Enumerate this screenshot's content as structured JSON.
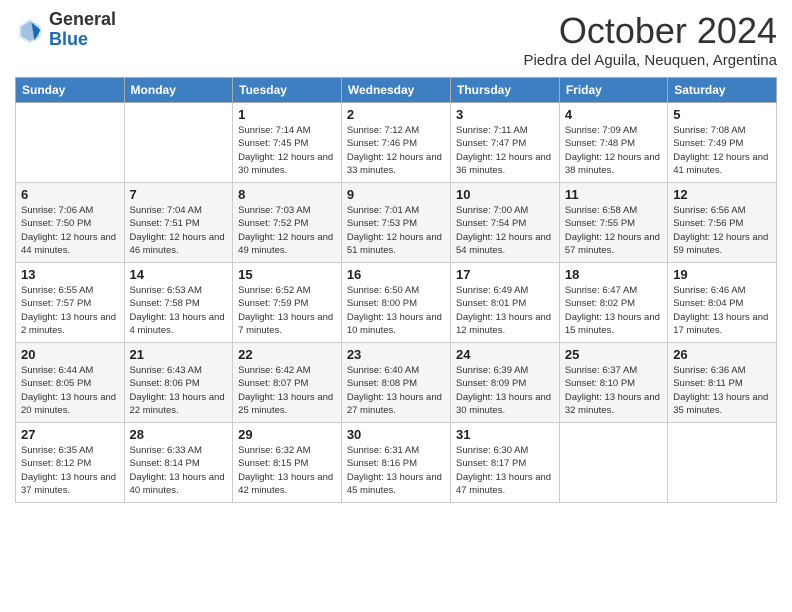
{
  "logo": {
    "general": "General",
    "blue": "Blue"
  },
  "header": {
    "month": "October 2024",
    "location": "Piedra del Aguila, Neuquen, Argentina"
  },
  "columns": [
    "Sunday",
    "Monday",
    "Tuesday",
    "Wednesday",
    "Thursday",
    "Friday",
    "Saturday"
  ],
  "weeks": [
    [
      {
        "day": "",
        "info": ""
      },
      {
        "day": "",
        "info": ""
      },
      {
        "day": "1",
        "info": "Sunrise: 7:14 AM\nSunset: 7:45 PM\nDaylight: 12 hours and 30 minutes."
      },
      {
        "day": "2",
        "info": "Sunrise: 7:12 AM\nSunset: 7:46 PM\nDaylight: 12 hours and 33 minutes."
      },
      {
        "day": "3",
        "info": "Sunrise: 7:11 AM\nSunset: 7:47 PM\nDaylight: 12 hours and 36 minutes."
      },
      {
        "day": "4",
        "info": "Sunrise: 7:09 AM\nSunset: 7:48 PM\nDaylight: 12 hours and 38 minutes."
      },
      {
        "day": "5",
        "info": "Sunrise: 7:08 AM\nSunset: 7:49 PM\nDaylight: 12 hours and 41 minutes."
      }
    ],
    [
      {
        "day": "6",
        "info": "Sunrise: 7:06 AM\nSunset: 7:50 PM\nDaylight: 12 hours and 44 minutes."
      },
      {
        "day": "7",
        "info": "Sunrise: 7:04 AM\nSunset: 7:51 PM\nDaylight: 12 hours and 46 minutes."
      },
      {
        "day": "8",
        "info": "Sunrise: 7:03 AM\nSunset: 7:52 PM\nDaylight: 12 hours and 49 minutes."
      },
      {
        "day": "9",
        "info": "Sunrise: 7:01 AM\nSunset: 7:53 PM\nDaylight: 12 hours and 51 minutes."
      },
      {
        "day": "10",
        "info": "Sunrise: 7:00 AM\nSunset: 7:54 PM\nDaylight: 12 hours and 54 minutes."
      },
      {
        "day": "11",
        "info": "Sunrise: 6:58 AM\nSunset: 7:55 PM\nDaylight: 12 hours and 57 minutes."
      },
      {
        "day": "12",
        "info": "Sunrise: 6:56 AM\nSunset: 7:56 PM\nDaylight: 12 hours and 59 minutes."
      }
    ],
    [
      {
        "day": "13",
        "info": "Sunrise: 6:55 AM\nSunset: 7:57 PM\nDaylight: 13 hours and 2 minutes."
      },
      {
        "day": "14",
        "info": "Sunrise: 6:53 AM\nSunset: 7:58 PM\nDaylight: 13 hours and 4 minutes."
      },
      {
        "day": "15",
        "info": "Sunrise: 6:52 AM\nSunset: 7:59 PM\nDaylight: 13 hours and 7 minutes."
      },
      {
        "day": "16",
        "info": "Sunrise: 6:50 AM\nSunset: 8:00 PM\nDaylight: 13 hours and 10 minutes."
      },
      {
        "day": "17",
        "info": "Sunrise: 6:49 AM\nSunset: 8:01 PM\nDaylight: 13 hours and 12 minutes."
      },
      {
        "day": "18",
        "info": "Sunrise: 6:47 AM\nSunset: 8:02 PM\nDaylight: 13 hours and 15 minutes."
      },
      {
        "day": "19",
        "info": "Sunrise: 6:46 AM\nSunset: 8:04 PM\nDaylight: 13 hours and 17 minutes."
      }
    ],
    [
      {
        "day": "20",
        "info": "Sunrise: 6:44 AM\nSunset: 8:05 PM\nDaylight: 13 hours and 20 minutes."
      },
      {
        "day": "21",
        "info": "Sunrise: 6:43 AM\nSunset: 8:06 PM\nDaylight: 13 hours and 22 minutes."
      },
      {
        "day": "22",
        "info": "Sunrise: 6:42 AM\nSunset: 8:07 PM\nDaylight: 13 hours and 25 minutes."
      },
      {
        "day": "23",
        "info": "Sunrise: 6:40 AM\nSunset: 8:08 PM\nDaylight: 13 hours and 27 minutes."
      },
      {
        "day": "24",
        "info": "Sunrise: 6:39 AM\nSunset: 8:09 PM\nDaylight: 13 hours and 30 minutes."
      },
      {
        "day": "25",
        "info": "Sunrise: 6:37 AM\nSunset: 8:10 PM\nDaylight: 13 hours and 32 minutes."
      },
      {
        "day": "26",
        "info": "Sunrise: 6:36 AM\nSunset: 8:11 PM\nDaylight: 13 hours and 35 minutes."
      }
    ],
    [
      {
        "day": "27",
        "info": "Sunrise: 6:35 AM\nSunset: 8:12 PM\nDaylight: 13 hours and 37 minutes."
      },
      {
        "day": "28",
        "info": "Sunrise: 6:33 AM\nSunset: 8:14 PM\nDaylight: 13 hours and 40 minutes."
      },
      {
        "day": "29",
        "info": "Sunrise: 6:32 AM\nSunset: 8:15 PM\nDaylight: 13 hours and 42 minutes."
      },
      {
        "day": "30",
        "info": "Sunrise: 6:31 AM\nSunset: 8:16 PM\nDaylight: 13 hours and 45 minutes."
      },
      {
        "day": "31",
        "info": "Sunrise: 6:30 AM\nSunset: 8:17 PM\nDaylight: 13 hours and 47 minutes."
      },
      {
        "day": "",
        "info": ""
      },
      {
        "day": "",
        "info": ""
      }
    ]
  ]
}
